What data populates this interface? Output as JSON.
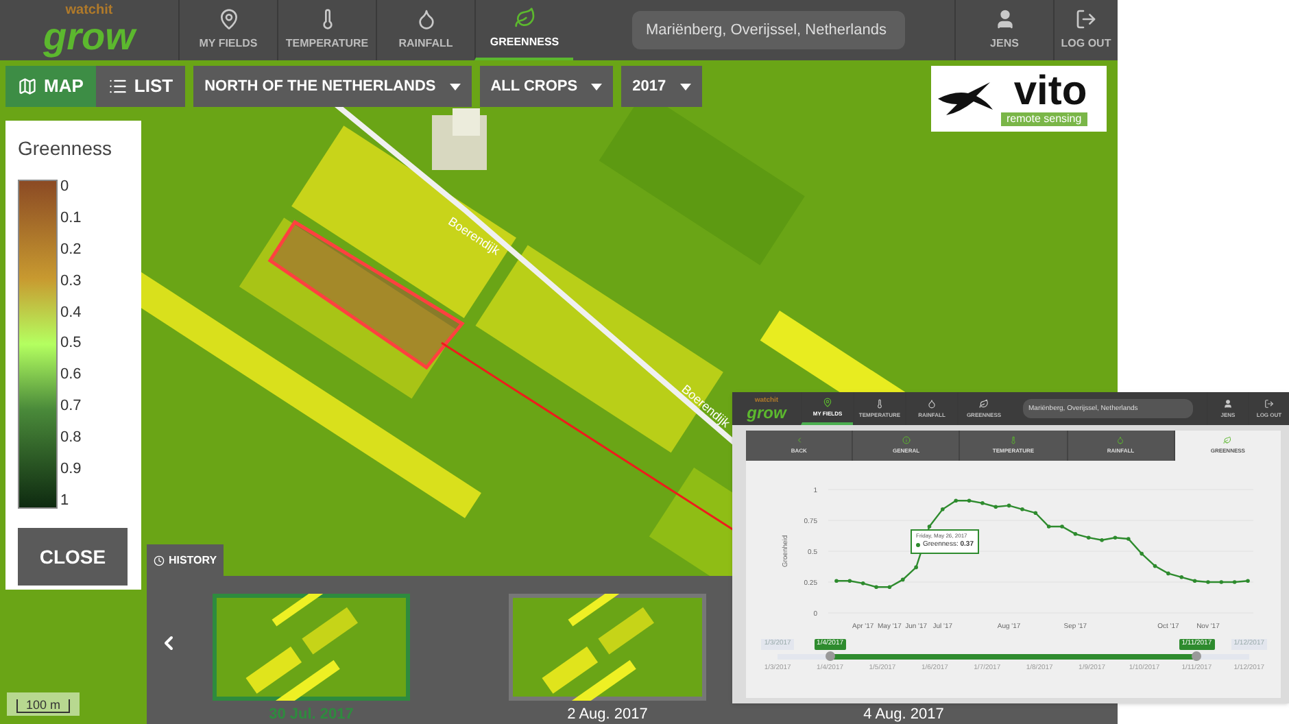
{
  "header": {
    "logo": {
      "top": "watchit",
      "bottom": "grow"
    },
    "nav": [
      {
        "label": "MY FIELDS",
        "selected": false
      },
      {
        "label": "TEMPERATURE",
        "selected": false
      },
      {
        "label": "RAINFALL",
        "selected": false
      },
      {
        "label": "GREENNESS",
        "selected": true
      }
    ],
    "search": {
      "value": "Mariënberg, Overijssel, Netherlands"
    },
    "user": "JENS",
    "logout": "LOG OUT"
  },
  "toolbar": {
    "views": [
      {
        "label": "MAP",
        "selected": true
      },
      {
        "label": "LIST",
        "selected": false
      }
    ],
    "dropdowns": [
      {
        "value": "NORTH OF THE NETHERLANDS"
      },
      {
        "value": "ALL CROPS"
      },
      {
        "value": "2017"
      }
    ]
  },
  "partner_logo": {
    "name": "vito",
    "tagline": "remote sensing"
  },
  "legend": {
    "title": "Greenness",
    "ticks": [
      "0",
      "0.1",
      "0.2",
      "0.3",
      "0.4",
      "0.5",
      "0.6",
      "0.7",
      "0.8",
      "0.9",
      "1"
    ],
    "close": "CLOSE"
  },
  "map": {
    "road_labels": [
      "Boerendijk",
      "Boerendijk"
    ],
    "scale": "100 m"
  },
  "history": {
    "tab": "HISTORY",
    "thumbnails": [
      {
        "date": "30 Jul. 2017",
        "selected": true
      },
      {
        "date": "2 Aug. 2017",
        "selected": false
      },
      {
        "date": "4 Aug. 2017"
      }
    ]
  },
  "inset": {
    "header": {
      "logo": {
        "top": "watchit",
        "bottom": "grow"
      },
      "nav": [
        {
          "label": "MY FIELDS",
          "selected": true
        },
        {
          "label": "TEMPERATURE",
          "selected": false
        },
        {
          "label": "RAINFALL",
          "selected": false
        },
        {
          "label": "GREENNESS",
          "selected": false
        }
      ],
      "search": {
        "value": "Mariënberg, Overijssel, Netherlands"
      },
      "user": "JENS",
      "logout": "LOG OUT"
    },
    "tabs": [
      {
        "label": "BACK",
        "selected": false
      },
      {
        "label": "GENERAL",
        "selected": false
      },
      {
        "label": "TEMPERATURE",
        "selected": false
      },
      {
        "label": "RAINFALL",
        "selected": false
      },
      {
        "label": "GREENNESS",
        "selected": true
      }
    ],
    "chart": {
      "chart_data": {
        "type": "line",
        "grid": true,
        "ylabel": "Groenheid",
        "ylim": [
          0,
          1
        ],
        "categories": [
          null,
          null,
          "Apr '17",
          null,
          "May '17",
          null,
          "Jun '17",
          null,
          "Jul '17",
          null,
          null,
          null,
          null,
          "Aug '17",
          null,
          null,
          null,
          null,
          "Sep '17",
          null,
          null,
          null,
          null,
          null,
          null,
          "Oct '17",
          null,
          null,
          "Nov '17",
          null,
          null,
          null
        ],
        "yticks": [
          {
            "value": 0,
            "label": "0"
          },
          {
            "value": 0.25,
            "label": "0.25"
          },
          {
            "value": 0.5,
            "label": "0.5"
          },
          {
            "value": 0.75,
            "label": "0.75"
          },
          {
            "value": 1,
            "label": "1"
          }
        ],
        "series": [
          {
            "color": "#2e8b2e",
            "values": [
              0.26,
              0.26,
              0.24,
              0.21,
              0.21,
              0.27,
              0.37,
              0.7,
              0.84,
              0.91,
              0.91,
              0.89,
              0.86,
              0.87,
              0.84,
              0.81,
              0.7,
              0.7,
              0.64,
              0.61,
              0.59,
              0.61,
              0.6,
              0.48,
              0.38,
              0.32,
              0.29,
              0.26,
              0.25,
              0.25,
              0.25,
              0.26
            ]
          }
        ]
      },
      "tooltip": {
        "date": "Friday, May 26, 2017",
        "text": "Greenness: **0.37**"
      }
    },
    "range_slider": {
      "min_label": "1/3/2017",
      "max_label": "1/12/2017",
      "handles": [
        {
          "label": "1/4/2017"
        },
        {
          "label": "1/11/2017"
        }
      ],
      "ticks": [
        "1/3/2017",
        "1/4/2017",
        "1/5/2017",
        "1/6/2017",
        "1/7/2017",
        "1/8/2017",
        "1/9/2017",
        "1/10/2017",
        "1/11/2017",
        "1/12/2017"
      ],
      "segments": [
        {
          "filled": false
        },
        {
          "filled": true
        },
        {
          "filled": true
        },
        {
          "filled": true
        },
        {
          "filled": true
        },
        {
          "filled": true
        },
        {
          "filled": true
        },
        {
          "filled": true
        },
        {
          "filled": false
        }
      ]
    }
  }
}
